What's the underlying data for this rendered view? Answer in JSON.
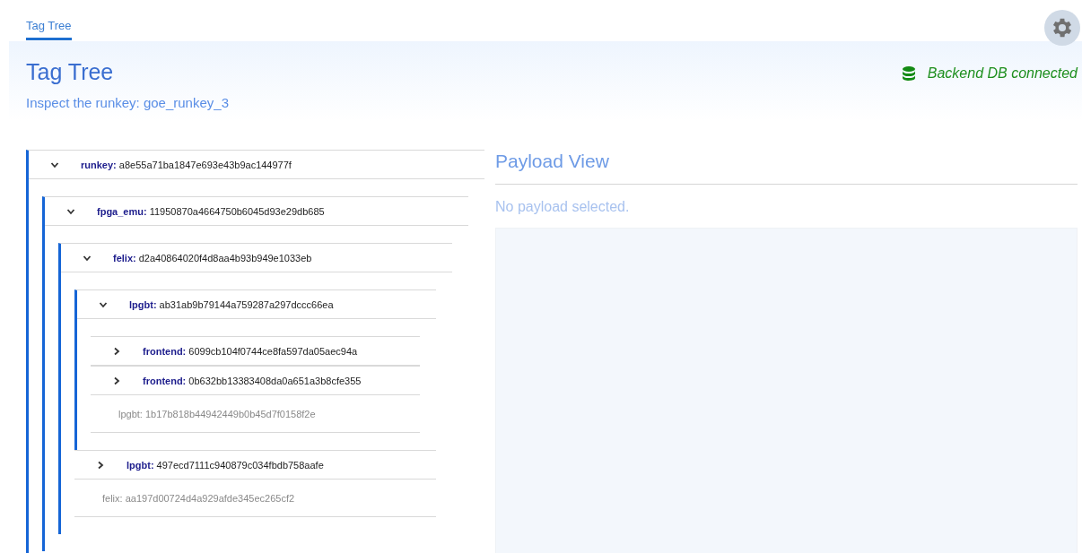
{
  "tabs": [
    {
      "label": "Tag Tree",
      "selected": true
    }
  ],
  "header": {
    "title": "Tag Tree",
    "subtitle": "Inspect the runkey: goe_runkey_3",
    "status": {
      "text": "Backend DB connected",
      "connected": true
    }
  },
  "tree": [
    {
      "kind": "branch",
      "key": "runkey:",
      "hash": "a8e55a71ba1847e693e43b9ac144977f",
      "expanded": true,
      "children": [
        {
          "kind": "branch",
          "key": "fpga_emu:",
          "hash": "11950870a4664750b6045d93e29db685",
          "expanded": true,
          "children": [
            {
              "kind": "branch",
              "key": "felix:",
              "hash": "d2a40864020f4d8aa4b93b949e1033eb",
              "expanded": true,
              "children": [
                {
                  "kind": "branch",
                  "key": "lpgbt:",
                  "hash": "ab31ab9b79144a759287a297dccc66ea",
                  "expanded": true,
                  "children": [
                    {
                      "kind": "branch",
                      "key": "frontend:",
                      "hash": "6099cb104f0744ce8fa597da05aec94a",
                      "expanded": false
                    },
                    {
                      "kind": "branch",
                      "key": "frontend:",
                      "hash": "0b632bb13383408da0a651a3b8cfe355",
                      "expanded": false
                    },
                    {
                      "kind": "leaf",
                      "key": "lpgbt:",
                      "hash": "1b17b818b44942449b0b45d7f0158f2e"
                    }
                  ]
                },
                {
                  "kind": "branch",
                  "key": "lpgbt:",
                  "hash": "497ecd7111c940879c034fbdb758aafe",
                  "expanded": false
                },
                {
                  "kind": "leaf",
                  "key": "felix:",
                  "hash": "aa197d00724d4a929afde345ec265cf2"
                }
              ]
            }
          ]
        }
      ]
    }
  ],
  "payload": {
    "title": "Payload View",
    "message": "No payload selected."
  }
}
